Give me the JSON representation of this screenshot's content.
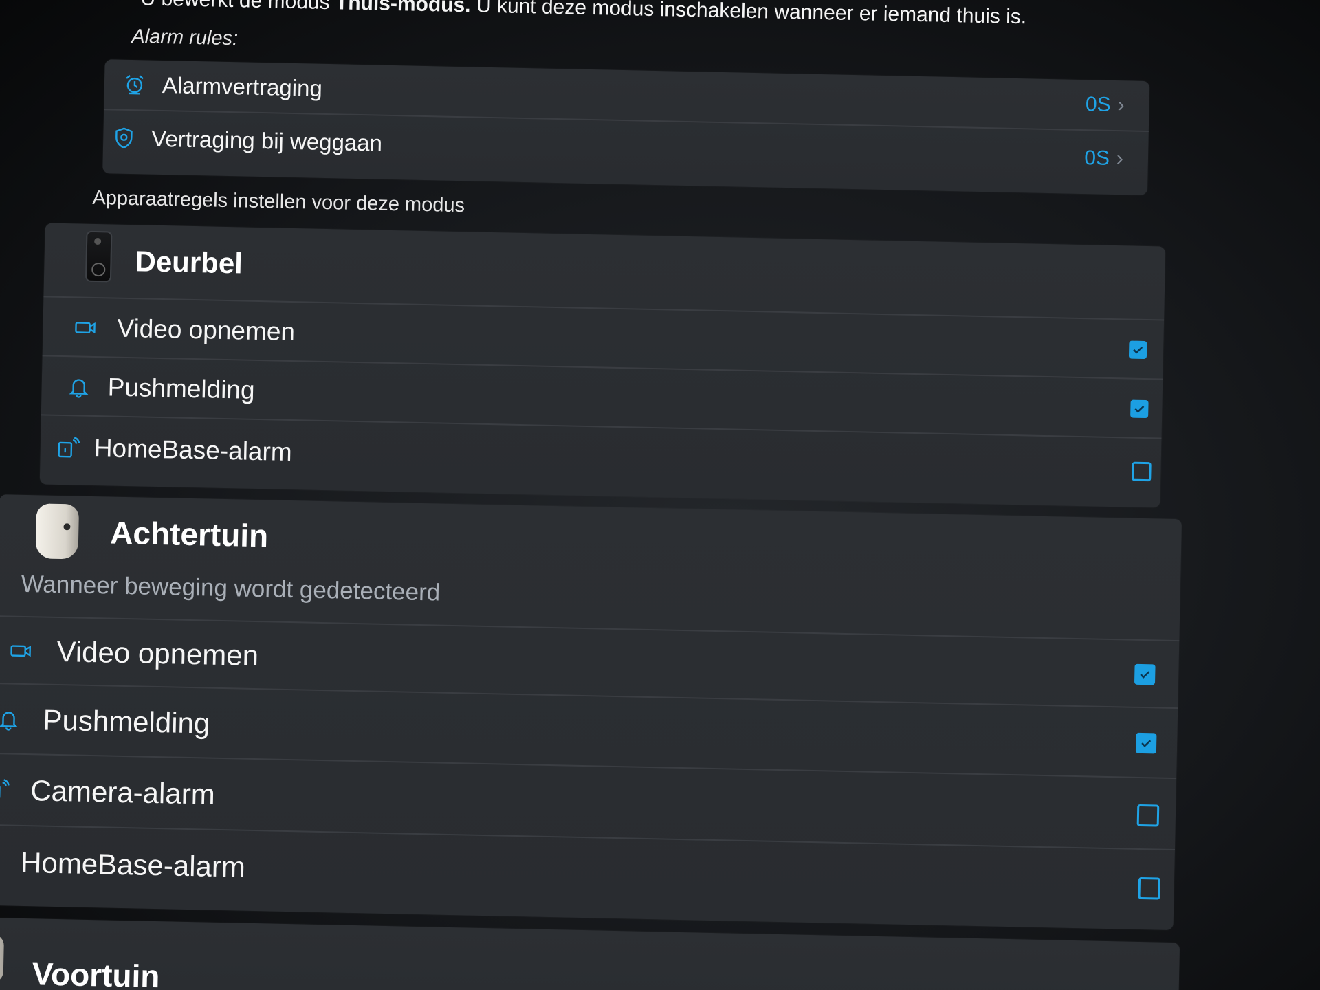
{
  "intro": {
    "prefix": "U bewerkt de modus ",
    "mode_name": "Thuis-modus.",
    "suffix": " U kunt deze modus inschakelen wanneer er iemand thuis is."
  },
  "alarm_rules": {
    "heading": "Alarm rules:",
    "items": [
      {
        "label": "Alarmvertraging",
        "value": "0S",
        "icon": "alarm-delay-icon"
      },
      {
        "label": "Vertraging bij weggaan",
        "value": "0S",
        "icon": "shield-icon"
      }
    ]
  },
  "device_rules_heading": "Apparaatregels instellen voor deze modus",
  "devices": [
    {
      "name": "Deurbel",
      "icon": "doorbell-device",
      "subtitle": "",
      "rules": [
        {
          "label": "Video opnemen",
          "icon": "video-camera-icon",
          "checked": true
        },
        {
          "label": "Pushmelding",
          "icon": "bell-icon",
          "checked": true
        },
        {
          "label": "HomeBase-alarm",
          "icon": "homebase-alarm-icon",
          "checked": false
        }
      ]
    },
    {
      "name": "Achtertuin",
      "icon": "camera-device",
      "subtitle": "Wanneer beweging wordt gedetecteerd",
      "rules": [
        {
          "label": "Video opnemen",
          "icon": "video-camera-icon",
          "checked": true
        },
        {
          "label": "Pushmelding",
          "icon": "bell-icon",
          "checked": true
        },
        {
          "label": "Camera-alarm",
          "icon": "camera-alarm-icon",
          "checked": false
        },
        {
          "label": "HomeBase-alarm",
          "icon": "homebase-alarm-icon",
          "checked": false
        }
      ]
    },
    {
      "name": "Voortuin",
      "icon": "camera-device",
      "subtitle": "",
      "rules": []
    }
  ],
  "colors": {
    "accent": "#1fa3e6",
    "card": "#2c2f33",
    "background": "#0b0c0e"
  }
}
